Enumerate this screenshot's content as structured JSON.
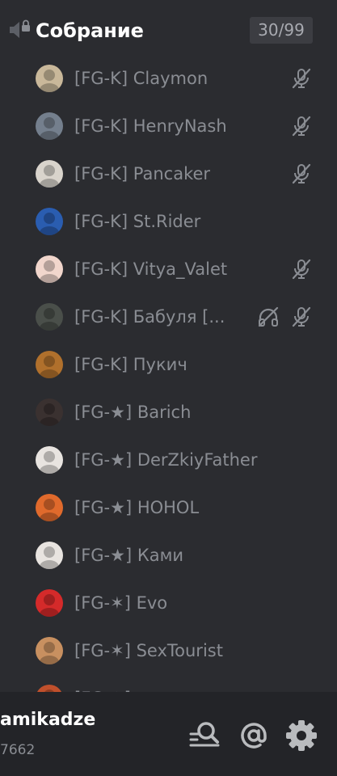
{
  "channel": {
    "title": "Собрание",
    "user_limit": "30/99",
    "icon": "speaker-locked-icon"
  },
  "members": [
    {
      "name": "[FG-K] Claymon",
      "muted": true,
      "deafened": false,
      "avatar_color": "#c9b89a"
    },
    {
      "name": "[FG-K] HenryNash",
      "muted": true,
      "deafened": false,
      "avatar_color": "#747f8d"
    },
    {
      "name": "[FG-K] Pancaker",
      "muted": true,
      "deafened": false,
      "avatar_color": "#d9d4cc"
    },
    {
      "name": "[FG-K] St.Rider",
      "muted": false,
      "deafened": false,
      "avatar_color": "#2a5db0"
    },
    {
      "name": "[FG-K] Vitya_Valet",
      "muted": true,
      "deafened": false,
      "avatar_color": "#f1d6cc"
    },
    {
      "name": "[FG-K] Бабуля [...",
      "muted": true,
      "deafened": true,
      "avatar_color": "#4a4f4a"
    },
    {
      "name": "[FG-K] Пукич",
      "muted": false,
      "deafened": false,
      "avatar_color": "#b0702c"
    },
    {
      "name": "[FG-★] Barich",
      "muted": false,
      "deafened": false,
      "avatar_color": "#3a3130"
    },
    {
      "name": "[FG-★] DerZkiyFather",
      "muted": false,
      "deafened": false,
      "avatar_color": "#e8e4e0"
    },
    {
      "name": "[FG-★] HOHOL",
      "muted": false,
      "deafened": false,
      "avatar_color": "#e06a2c"
    },
    {
      "name": "[FG-★] Ками",
      "muted": false,
      "deafened": false,
      "avatar_color": "#e8e4e0"
    },
    {
      "name": "[FG-✶] Evo",
      "muted": false,
      "deafened": false,
      "avatar_color": "#d42a2a"
    },
    {
      "name": "[FG-✶] SexTourist",
      "muted": false,
      "deafened": false,
      "avatar_color": "#c89060"
    },
    {
      "name": "[FG-✶] ...",
      "muted": false,
      "deafened": false,
      "avatar_color": "#c0502c"
    }
  ],
  "user_panel": {
    "username": "amikadze",
    "discriminator": "7662",
    "buttons": [
      {
        "name": "search-icon"
      },
      {
        "name": "mentions-icon"
      },
      {
        "name": "settings-gear-icon"
      }
    ]
  },
  "colors": {
    "background": "#2b2c30",
    "panel": "#232428",
    "text_primary": "#ffffff",
    "text_muted": "#8a8d93",
    "icon": "#b9bbbe"
  }
}
